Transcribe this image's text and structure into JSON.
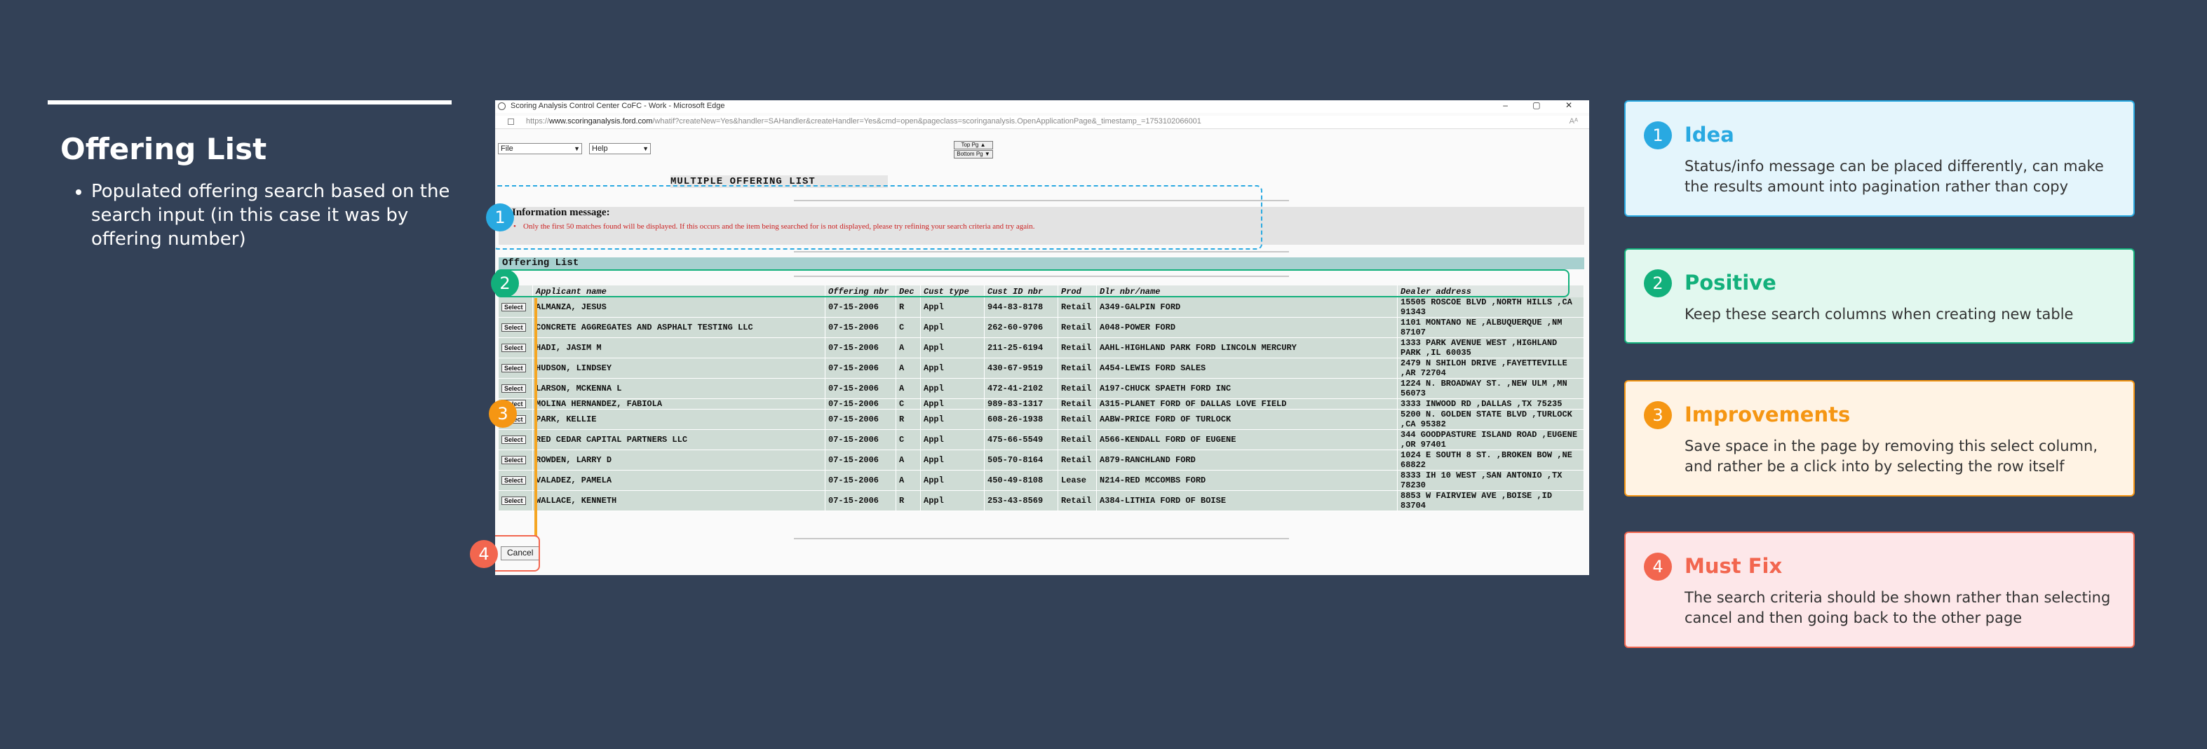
{
  "left": {
    "title": "Offering List",
    "bullet": "Populated offering search based on the search input (in this case it was by offering number)"
  },
  "window": {
    "title": "Scoring Analysis Control Center   CoFC - Work - Microsoft Edge",
    "url_prefix": "https://",
    "url_host": "www.scoringanalysis.ford.com",
    "url_rest": "/whatif?createNew=Yes&handler=SAHandler&createHandler=Yes&cmd=open&pageclass=scoringanalysis.OpenApplicationPage&_timestamp_=1753102066001",
    "controls": "–  ▢  ✕",
    "reader_icon": "Aᴬ"
  },
  "menu": {
    "file": "File",
    "help": "Help",
    "top_pg": "Top Pg ▲",
    "bottom_pg": "Bottom Pg ▼"
  },
  "page": {
    "heading": "MULTIPLE OFFERING LIST",
    "info_title": "Information message:",
    "info_message": "Only the first 50 matches found will be displayed. If this occurs and the item being searched for is not displayed, please try refining your search criteria and try again.",
    "offering_list_title": "Offering List",
    "select_label": "Select",
    "cancel_label": "Cancel",
    "columns": [
      "",
      "Applicant name",
      "Offering nbr",
      "Dec",
      "Cust type",
      "Cust ID nbr",
      "Prod",
      "Dlr nbr/name",
      "Dealer address"
    ],
    "rows": [
      {
        "name": "ALMANZA, JESUS",
        "offer": "07-15-2006",
        "dec": "R",
        "ctype": "Appl",
        "cid": "944-83-8178",
        "prod": "Retail",
        "dlr": "A349-GALPIN FORD",
        "addr": "15505 ROSCOE BLVD ,NORTH HILLS ,CA 91343"
      },
      {
        "name": "CONCRETE AGGREGATES AND ASPHALT TESTING LLC",
        "offer": "07-15-2006",
        "dec": "C",
        "ctype": "Appl",
        "cid": "262-60-9706",
        "prod": "Retail",
        "dlr": "A048-POWER FORD",
        "addr": "1101 MONTANO NE ,ALBUQUERQUE ,NM 87107"
      },
      {
        "name": "HADI, JASIM M",
        "offer": "07-15-2006",
        "dec": "A",
        "ctype": "Appl",
        "cid": "211-25-6194",
        "prod": "Retail",
        "dlr": "AAHL-HIGHLAND PARK FORD LINCOLN MERCURY",
        "addr": "1333 PARK AVENUE WEST ,HIGHLAND PARK ,IL 60035"
      },
      {
        "name": "HUDSON, LINDSEY",
        "offer": "07-15-2006",
        "dec": "A",
        "ctype": "Appl",
        "cid": "430-67-9519",
        "prod": "Retail",
        "dlr": "A454-LEWIS FORD SALES",
        "addr": "2479 N SHILOH DRIVE ,FAYETTEVILLE ,AR 72704"
      },
      {
        "name": "LARSON, MCKENNA L",
        "offer": "07-15-2006",
        "dec": "A",
        "ctype": "Appl",
        "cid": "472-41-2102",
        "prod": "Retail",
        "dlr": "A197-CHUCK SPAETH FORD INC",
        "addr": "1224 N. BROADWAY ST. ,NEW ULM ,MN 56073"
      },
      {
        "name": "MOLINA HERNANDEZ, FABIOLA",
        "offer": "07-15-2006",
        "dec": "C",
        "ctype": "Appl",
        "cid": "989-83-1317",
        "prod": "Retail",
        "dlr": "A315-PLANET FORD OF DALLAS LOVE FIELD",
        "addr": "3333 INWOOD RD ,DALLAS ,TX 75235"
      },
      {
        "name": "PARK, KELLIE",
        "offer": "07-15-2006",
        "dec": "R",
        "ctype": "Appl",
        "cid": "608-26-1938",
        "prod": "Retail",
        "dlr": "AABW-PRICE FORD OF TURLOCK",
        "addr": "5200 N. GOLDEN STATE BLVD ,TURLOCK ,CA 95382"
      },
      {
        "name": "RED CEDAR CAPITAL PARTNERS LLC",
        "offer": "07-15-2006",
        "dec": "C",
        "ctype": "Appl",
        "cid": "475-66-5549",
        "prod": "Retail",
        "dlr": "A566-KENDALL FORD OF EUGENE",
        "addr": "344 GOODPASTURE ISLAND ROAD ,EUGENE ,OR 97401"
      },
      {
        "name": "ROWDEN, LARRY D",
        "offer": "07-15-2006",
        "dec": "A",
        "ctype": "Appl",
        "cid": "505-70-8164",
        "prod": "Retail",
        "dlr": "A879-RANCHLAND FORD",
        "addr": "1024 E SOUTH 8 ST. ,BROKEN BOW ,NE 68822"
      },
      {
        "name": "VALADEZ, PAMELA",
        "offer": "07-15-2006",
        "dec": "A",
        "ctype": "Appl",
        "cid": "450-49-8108",
        "prod": "Lease",
        "dlr": "N214-RED MCCOMBS FORD",
        "addr": "8333 IH 10 WEST ,SAN ANTONIO ,TX 78230"
      },
      {
        "name": "WALLACE, KENNETH",
        "offer": "07-15-2006",
        "dec": "R",
        "ctype": "Appl",
        "cid": "253-43-8569",
        "prod": "Retail",
        "dlr": "A384-LITHIA FORD OF BOISE",
        "addr": "8853 W FAIRVIEW AVE ,BOISE ,ID 83704"
      }
    ]
  },
  "markers": [
    "1",
    "2",
    "3",
    "4"
  ],
  "cards": [
    {
      "num": "1",
      "title": "Idea",
      "body": "Status/info message can be placed differently, can make the results amount into pagination rather than copy",
      "color": "#29a9e1",
      "bg": "#e4f5fc"
    },
    {
      "num": "2",
      "title": "Positive",
      "body": "Keep these search columns when creating new table",
      "color": "#12b07b",
      "bg": "#e2f8ef"
    },
    {
      "num": "3",
      "title": "Improvements",
      "body": "Save space in the page by removing this select column, and rather be a click into by selecting the row itself",
      "color": "#f59613",
      "bg": "#fff3e4"
    },
    {
      "num": "4",
      "title": "Must Fix",
      "body": "The search criteria should be shown rather than selecting cancel and then going back to the other page",
      "color": "#f2664f",
      "bg": "#fde7e9"
    }
  ]
}
